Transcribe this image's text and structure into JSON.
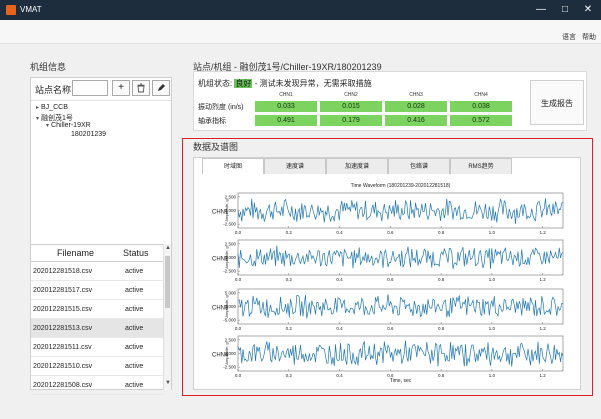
{
  "window": {
    "title": "VMAT",
    "minimize_glyph": "—",
    "maximize_glyph": "□",
    "close_glyph": "✕"
  },
  "menu": {
    "items": [
      {
        "label": "语言"
      },
      {
        "label": "帮助"
      }
    ]
  },
  "left": {
    "title": "机组信息",
    "station_label": "站点名称",
    "station_value": "",
    "tree": [
      {
        "caret": "▸",
        "label": "BJ_CCB"
      },
      {
        "caret": "▾",
        "label": "融创茂1号"
      },
      {
        "caret": "▾",
        "label": "Chiller-19XR"
      },
      {
        "caret": "",
        "label": "180201239"
      }
    ],
    "files": {
      "headers": [
        "Filename",
        "Status"
      ],
      "rows": [
        {
          "name": "202012281518.csv",
          "status": "active"
        },
        {
          "name": "202012281517.csv",
          "status": "active"
        },
        {
          "name": "202012281515.csv",
          "status": "active"
        },
        {
          "name": "202012281513.csv",
          "status": "active"
        },
        {
          "name": "202012281511.csv",
          "status": "active"
        },
        {
          "name": "202012281510.csv",
          "status": "active"
        },
        {
          "name": "202012281508.csv",
          "status": "active"
        }
      ]
    }
  },
  "site": {
    "path": "站点/机组 - 融创茂1号/Chiller-19XR/180201239",
    "status_label": "机组状态:",
    "status_value": "良好",
    "status_desc": "- 测试未发现异常，无需采取措施",
    "channels": [
      "CHN1",
      "CHN2",
      "CHN3",
      "CHN4"
    ],
    "rows": [
      {
        "label": "振动烈度 (in/s)",
        "values": [
          "0.033",
          "0.015",
          "0.028",
          "0.038"
        ]
      },
      {
        "label": "轴承指标",
        "values": [
          "0.491",
          "0.179",
          "0.416",
          "0.572"
        ]
      }
    ],
    "report_button": "生成报告",
    "colors": {
      "good": "#6ac35a",
      "metric": "#7dd35f",
      "highlight_border": "#e02020",
      "signal": "#1f77b4"
    }
  },
  "data_section": {
    "title": "数据及谱图",
    "tabs": [
      "时域图",
      "速度谱",
      "加速度谱",
      "包络谱",
      "RMS趋势"
    ],
    "active_tab": 0
  },
  "chart_data": {
    "type": "line",
    "title": "Time Waveform (180201239-202012281518)",
    "xlabel": "Time, sec",
    "ylabel": "Amplitude, g",
    "xlim": [
      0,
      1.28
    ],
    "x_ticks": [
      "0.0",
      "0.2",
      "0.4",
      "0.6",
      "0.8",
      "1.0",
      "1.2"
    ],
    "grid": false,
    "series": [
      {
        "name": "CHN1",
        "ylim": [
          -3.2,
          3.2
        ],
        "y_ticks": [
          "2.500",
          "0.000",
          "-2.500"
        ],
        "amplitude": 2.5
      },
      {
        "name": "CHN2",
        "ylim": [
          -3.2,
          3.2
        ],
        "y_ticks": [
          "2.500",
          "0.000",
          "-2.500"
        ],
        "amplitude": 2.3
      },
      {
        "name": "CHN3",
        "ylim": [
          -6.5,
          6.5
        ],
        "y_ticks": [
          "5.000",
          "0.000",
          "-5.000"
        ],
        "amplitude": 4.8
      },
      {
        "name": "CHN4",
        "ylim": [
          -3.2,
          3.2
        ],
        "y_ticks": [
          "2.500",
          "0.000",
          "-2.500"
        ],
        "amplitude": 2.6
      }
    ]
  }
}
